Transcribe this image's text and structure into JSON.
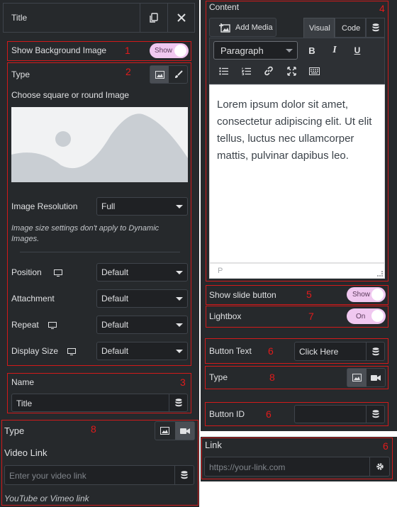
{
  "header": {
    "title": "Title"
  },
  "background": {
    "label": "Show Background Image",
    "toggle_text": "Show",
    "annotation": "1"
  },
  "image_section": {
    "annotation": "2",
    "type_label": "Type",
    "choose_label": "Choose square or round Image",
    "resolution_label": "Image Resolution",
    "resolution_value": "Full",
    "hint": "Image size settings don't apply to Dynamic Images.",
    "rows": [
      {
        "label": "Position",
        "value": "Default"
      },
      {
        "label": "Attachment",
        "value": "Default"
      },
      {
        "label": "Repeat",
        "value": "Default"
      },
      {
        "label": "Display Size",
        "value": "Default"
      }
    ]
  },
  "name_section": {
    "annotation": "3",
    "label": "Name",
    "value": "Title"
  },
  "video_section": {
    "annotation": "8",
    "type_label": "Type",
    "link_label": "Video Link",
    "placeholder": "Enter your video link",
    "hint": "YouTube or Vimeo link"
  },
  "content": {
    "annotation": "4",
    "label": "Content",
    "add_media": "Add Media",
    "tab_visual": "Visual",
    "tab_code": "Code",
    "format_value": "Paragraph",
    "body": "Lorem ipsum dolor sit amet, consectetur adipiscing elit. Ut elit tellus, luctus nec ullamcorper mattis, pulvinar dapibus leo.",
    "path_label": "P"
  },
  "slide_button": {
    "annotation": "5",
    "label": "Show slide button",
    "toggle_text": "Show"
  },
  "lightbox": {
    "annotation": "7",
    "label": "Lightbox",
    "toggle_text": "On"
  },
  "button_text": {
    "annotation": "6",
    "label": "Button Text",
    "value": "Click Here"
  },
  "button_type": {
    "annotation": "8",
    "label": "Type"
  },
  "button_id": {
    "annotation": "6",
    "label": "Button ID",
    "value": ""
  },
  "link": {
    "annotation": "6",
    "label": "Link",
    "placeholder": "https://your-link.com"
  },
  "colors": {
    "panel": "#26292c",
    "input": "#1f2124",
    "annotation": "#d11a1a",
    "toggle_on": "#f0c8f0"
  }
}
